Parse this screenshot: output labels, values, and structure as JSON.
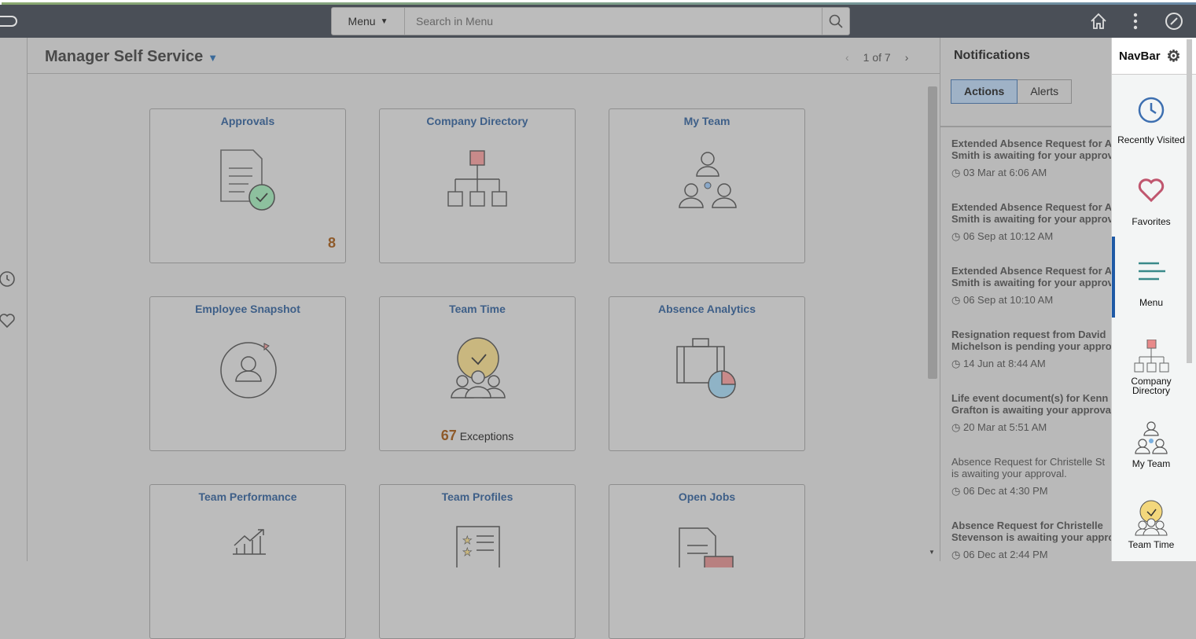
{
  "header": {
    "menu_label": "Menu",
    "search_placeholder": "Search in Menu"
  },
  "page": {
    "title": "Manager Self Service",
    "pager": "1 of 7"
  },
  "tiles": [
    {
      "title": "Approvals",
      "badge": "8"
    },
    {
      "title": "Company Directory"
    },
    {
      "title": "My Team"
    },
    {
      "title": "Employee Snapshot"
    },
    {
      "title": "Team Time",
      "count": "67",
      "count_label": "Exceptions"
    },
    {
      "title": "Absence Analytics"
    },
    {
      "title": "Team Performance"
    },
    {
      "title": "Team Profiles"
    },
    {
      "title": "Open Jobs"
    }
  ],
  "notifications": {
    "title": "Notifications",
    "tabs": [
      "Actions",
      "Alerts"
    ],
    "items": [
      {
        "line1": "Extended Absence Request for A",
        "line2": "Smith is awaiting for your approval",
        "date": "03 Mar at 6:06 AM",
        "bold": true
      },
      {
        "line1": "Extended Absence Request for A",
        "line2": "Smith is awaiting for your approval",
        "date": "06 Sep at 10:12 AM",
        "bold": true
      },
      {
        "line1": "Extended Absence Request for A",
        "line2": "Smith is awaiting for your approval",
        "date": "06 Sep at 10:10 AM",
        "bold": true
      },
      {
        "line1": "Resignation request from David",
        "line2": "Michelson is pending your approval",
        "date": "14 Jun at 8:44 AM",
        "bold": true
      },
      {
        "line1": "Life event document(s) for Kenn",
        "line2": "Grafton is awaiting your approval",
        "date": "20 Mar at 5:51 AM",
        "bold": true
      },
      {
        "line1": "Absence Request for Christelle St",
        "line2": "is awaiting your approval.",
        "date": "06 Dec at 4:30 PM",
        "bold": false
      },
      {
        "line1": "Absence Request for Christelle",
        "line2": "Stevenson is awaiting your approval",
        "date": "06 Dec at 2:44 PM",
        "bold": true
      }
    ]
  },
  "navbar": {
    "title": "NavBar",
    "items": [
      "Recently Visited",
      "Favorites",
      "Menu",
      "Company Directory",
      "My Team",
      "Team Time"
    ]
  }
}
